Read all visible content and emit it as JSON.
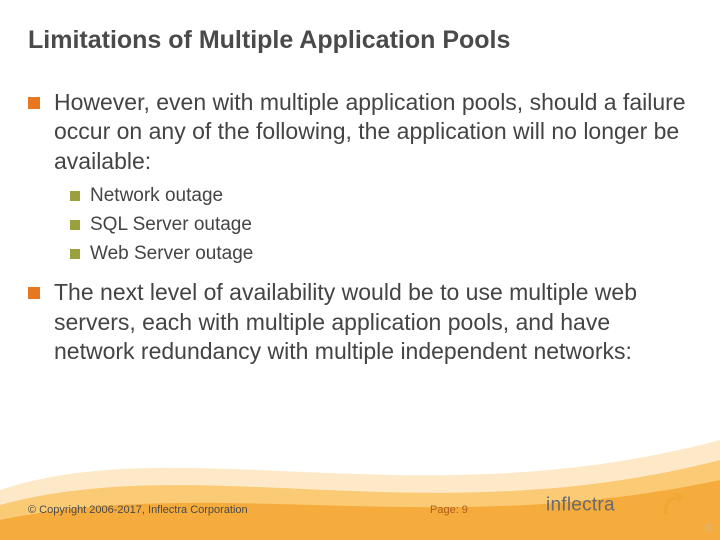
{
  "title": "Limitations of Multiple Application Pools",
  "bullets": {
    "b1": "However, even with multiple application pools, should a failure occur on any of the following, the application will no longer be available:",
    "sub": {
      "s1": "Network outage",
      "s2": "SQL Server outage",
      "s3": "Web Server outage"
    },
    "b2": "The next level of availability would be to use multiple web servers, each with multiple application pools, and have network redundancy with multiple independent networks:"
  },
  "footer": {
    "copyright": "© Copyright 2006-2017, Inflectra Corporation",
    "page_label": "Page: 9",
    "logo_text": "inflectra",
    "registered": "®"
  },
  "colors": {
    "bullet1": "#e87722",
    "bullet2": "#9aa03b",
    "swoosh_light": "#fde9c8",
    "swoosh_mid": "#f9c66a",
    "swoosh_dark": "#f3a733"
  }
}
